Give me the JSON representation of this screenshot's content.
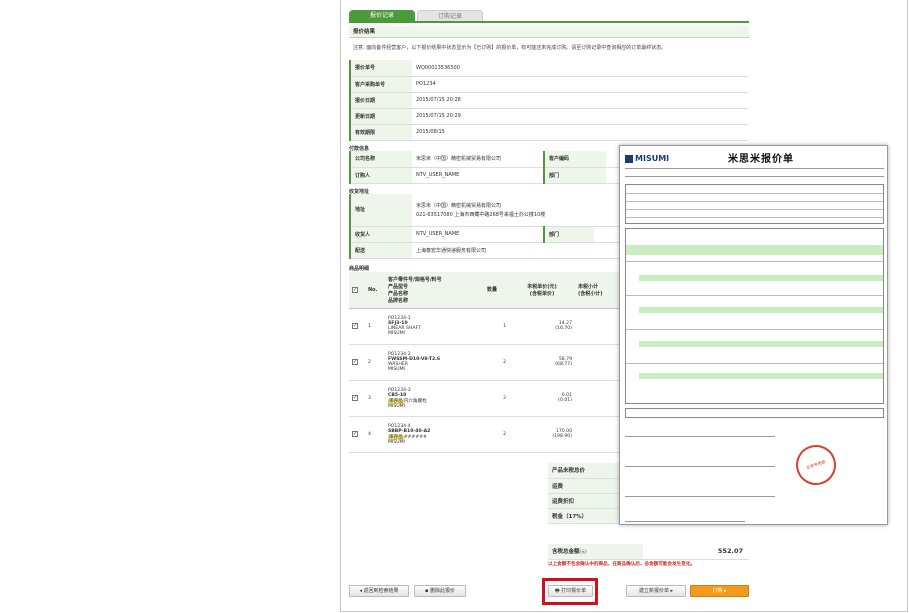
{
  "tabs": [
    {
      "label": "报价记录",
      "active": true
    },
    {
      "label": "订购记录",
      "active": false
    }
  ],
  "result_header": "报价结果",
  "notice": "注意: 面向备件经营客户，以下报价结果中状态显示为【已订购】的报价单，有可能还未完成订购。请至订购记录中查询相应的订单最终状态。",
  "quote_info": [
    {
      "k": "报价单号",
      "v": "WQ00013536500"
    },
    {
      "k": "客户采购单号",
      "v": "PO1234"
    },
    {
      "k": "报价日期",
      "v": "2015/07/15 20:28"
    },
    {
      "k": "更新日期",
      "v": "2015/07/15 20:29"
    },
    {
      "k": "有效期限",
      "v": "2015/08/15"
    }
  ],
  "payer_label": "付款信息",
  "payer": {
    "company_k": "公司名称",
    "company_v": "米思米（中国）精密机械贸易有限公司",
    "code_k": "客户编码",
    "person_k": "订购人",
    "person_v": "NTV_USER_NAME",
    "dept_k": "部门"
  },
  "ship_label": "收货地址",
  "ship": {
    "addr_k": "地址",
    "addr_v1": "米思米（中国）精密机械贸易有限公司",
    "addr_v2": "021-63517080 上海市西藏中路268号来福士办公楼10楼",
    "recv_k": "收货人",
    "recv_v": "NTV_USER_NAME",
    "dept_k": "部门",
    "carrier_k": "配送",
    "carrier_v": "上海泰宏华通快递服务有限公司"
  },
  "items_label": "商品明细",
  "items_header": {
    "no": "No.",
    "part": "客户零件号/规格号/料号",
    "model": "产品型号",
    "name": "产品名称",
    "brand": "品牌名称",
    "qty": "数量",
    "unit": "未税单价",
    "unit_note": "(元)",
    "unit_tax": "(含税单价)",
    "sub": "未税小计",
    "sub_tax": "(含税小计)"
  },
  "items": [
    {
      "no": "1",
      "part": "PO1234-1",
      "model": "SFJ3-10",
      "name": "LINEAR SHAFT",
      "tag": "",
      "brand": "MISUMI",
      "qty": "1",
      "unit": "14.27",
      "unit_tax": "(16.70)"
    },
    {
      "no": "2",
      "part": "PO1234-2",
      "model": "FWSSM-D10-V8-T2.6",
      "name": "WASHER",
      "tag": "",
      "brand": "MISUMI",
      "qty": "2",
      "unit": "58.79",
      "unit_tax": "(68.77)"
    },
    {
      "no": "3",
      "part": "PO1234-3",
      "model": "CB5-10",
      "name": "内六角螺栓",
      "tag": "库存品",
      "brand": "MISUMI",
      "qty": "2",
      "unit": "0.01",
      "unit_tax": "(0.01)"
    },
    {
      "no": "4",
      "part": "PO1234-4",
      "model": "SBBP-B10-40-A2",
      "name": "######",
      "tag": "库存品",
      "brand": "MISUMI",
      "qty": "2",
      "unit": "170.00",
      "unit_tax": "(198.90)"
    }
  ],
  "summary": [
    {
      "k": "产品未税总价",
      "v": ""
    },
    {
      "k": "运费",
      "v": ""
    },
    {
      "k": "运费折扣",
      "v": ""
    },
    {
      "k": "税金（17%）",
      "v": ""
    }
  ],
  "total": {
    "k": "含税总金额",
    "unit": "(元)",
    "v": "552.07"
  },
  "total_note": "以上金额不包含确认中的商品，在商品确认后，总金额可能会发生变化。",
  "buttons": {
    "back": "返回到检索结果",
    "delete": "删除此报价",
    "print": "打印报价单",
    "new_quote": "建立新报价单",
    "order": "订购"
  },
  "doc": {
    "logo": "MISUMI",
    "title": "米思米报价单",
    "stamp": "业务专用章"
  }
}
